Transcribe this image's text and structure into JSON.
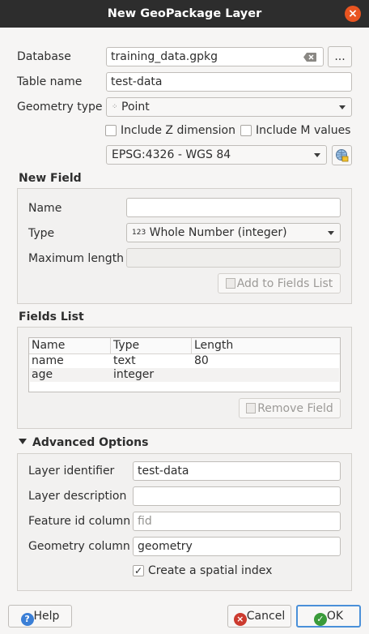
{
  "window": {
    "title": "New GeoPackage Layer"
  },
  "database": {
    "label": "Database",
    "value": "training_data.gpkg",
    "browse_label": "..."
  },
  "table_name": {
    "label": "Table name",
    "value": "test-data"
  },
  "geometry_type": {
    "label": "Geometry type",
    "value": "Point",
    "icon": "point-geometry-icon"
  },
  "include_z": {
    "label": "Include Z dimension",
    "checked": false
  },
  "include_m": {
    "label": "Include M values",
    "checked": false
  },
  "crs": {
    "value": "EPSG:4326 - WGS 84",
    "icon": "projection-selector-icon"
  },
  "new_field": {
    "title": "New Field",
    "name_label": "Name",
    "name_value": "",
    "type_label": "Type",
    "type_value": "Whole Number (integer)",
    "type_prefix": "123",
    "max_length_label": "Maximum length",
    "max_length_value": "",
    "add_button": "Add to Fields List"
  },
  "fields_list": {
    "title": "Fields List",
    "columns": [
      "Name",
      "Type",
      "Length"
    ],
    "rows": [
      {
        "name": "name",
        "type": "text",
        "length": "80"
      },
      {
        "name": "age",
        "type": "integer",
        "length": ""
      }
    ],
    "remove_button": "Remove Field"
  },
  "advanced": {
    "title": "Advanced Options",
    "expanded": true,
    "layer_identifier_label": "Layer identifier",
    "layer_identifier_value": "test-data",
    "layer_description_label": "Layer description",
    "layer_description_value": "",
    "feature_id_label": "Feature id column",
    "feature_id_placeholder": "fid",
    "geometry_column_label": "Geometry column",
    "geometry_column_value": "geometry",
    "spatial_index_label": "Create a spatial index",
    "spatial_index_checked": true
  },
  "buttons": {
    "help": "Help",
    "cancel": "Cancel",
    "ok": "OK"
  },
  "colors": {
    "titlebar": "#2d2d2d",
    "close": "#e95420",
    "help_icon": "#3b7fd6",
    "cancel_icon": "#cc3b2f",
    "ok_icon": "#3a9b3a",
    "ok_border": "#4a90d9"
  }
}
